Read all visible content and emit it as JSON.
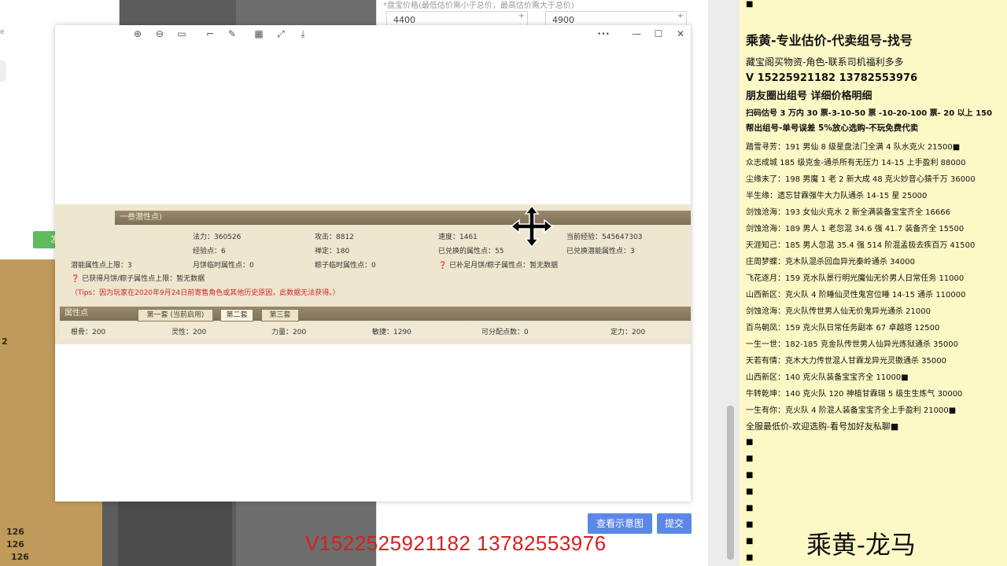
{
  "chat": {
    "small_label": "e",
    "send_label": "发送(S)",
    "side_numbers": [
      "2",
      "126",
      "126",
      "126"
    ]
  },
  "bg_form": {
    "hint": "*盘宝价格(最低估价需小于总价，最高估价需大于总价)",
    "min_price": "4400",
    "max_price": "4900",
    "view_sample_label": "查看示意图",
    "submit_label": "提交"
  },
  "viewer": {
    "toolbar_icons": [
      "zoom-in-icon",
      "zoom-out-icon",
      "fit-icon",
      "crop-icon",
      "edit-icon",
      "mosaic-icon",
      "fullscreen-icon",
      "download-icon"
    ],
    "more_label": "•••",
    "minimize_label": "—",
    "maximize_label": "☐",
    "close_label": "✕"
  },
  "game": {
    "section1_title": "一叁潜性点)",
    "row1": [
      "法力：360526",
      "攻击：8812",
      "速度：1461",
      "当前经验：545647303"
    ],
    "row2": [
      "经验点：6",
      "禅定：180",
      "已兑换的属性点：55",
      "已兑换潜能属性点：3"
    ],
    "row3": [
      "潜能属性点上限：3",
      "月饼临时属性点：0",
      "粽子临时属性点：0",
      "已补足月饼/粽子属性点：暂无数据"
    ],
    "row4": "已获得月饼/粽子属性点上限：暂无数据",
    "tips": "（Tips：因为玩家在2020年9月24日前寄售角色或其他历史原因，此数据无法获得。）",
    "section2_title": "属性点",
    "tabs": [
      "第一套 (当前启用)",
      "第二套",
      "第三套"
    ],
    "attrs": [
      "根骨：200",
      "灵性：200",
      "力量：200",
      "敏捷：1290",
      "可分配点数：0",
      "定力：200"
    ]
  },
  "red_contact": "V1522525921182  13782553976",
  "ad": {
    "title": "乘黄-专业估价-代卖组号-找号",
    "lines": [
      "藏宝阁买物资-角色-联系司机福利多多",
      "V 15225921182    13782553976",
      "朋友圈出组号    详细价格明细",
      "扫码估号 3 万内 30 票-3-10-50 票  -10-20-100 票- 20 以上 150",
      "帮出组号-单号误差 5%放心选购-不玩免费代卖",
      "踏雪寻芳：191 男仙 8 级星盘法门全满 4 队水克火 21500■",
      "众志成城  185 级克金-通杀所有无压力 14-15 上手盈利 88000",
      "尘缘未了：198 男魔 1 老 2 新大成 48 克火妙音心猿千万 36000",
      "半生缘：遗忘甘霖强牛大力队通杀 14-15 星 25000",
      "剑蚀沧海：193 女仙火克水 2 新全满装备宝宝齐全 16666",
      "剑蚀沧海：189 男人 1 老忽混 34.6 强 41.7 装备齐全 15500",
      "天涯知己：185 男人忽混 35.4 强 514 阶混孟极去疾百万 41500",
      "庄周梦蝶：克木队混杀回血异光秦岭通杀 34000",
      "飞花逐月：159 克水队景行明光魔仙无价男人日常任务 11000",
      "山西新区：克火队 4 阶睡仙灵性鬼宫位睡 14-15 通杀 110000",
      "剑蚀沧海：克火队传世男人仙无价鬼异光通杀 21000",
      "百鸟朝凤：159 克火队日常任务副本 67 卓越塔 12500",
      "一生一世：182-185 克金队传世男人仙异光炼狱通杀 35000",
      "天若有情：克木大力传世混人甘霖龙异光灵擞通杀 35000",
      "山西新区：140 克火队装备宝宝齐全  11000■",
      "牛转乾坤：140 克火队 120 神植甘霖瑞 5 级生生炼气 30000",
      "一生有你：克火队 4 阶混人装备宝宝齐全上手盈利 21000■",
      "全服最低价-欢迎选购-看号加好友私聊■"
    ],
    "name": "乘黄-龙马",
    "square": "■"
  },
  "colors": {
    "ad_bg": "#fdf9c6",
    "red_text": "#d81e1e",
    "blue_button": "#5b88e6",
    "green_button": "#5fbb5f"
  }
}
